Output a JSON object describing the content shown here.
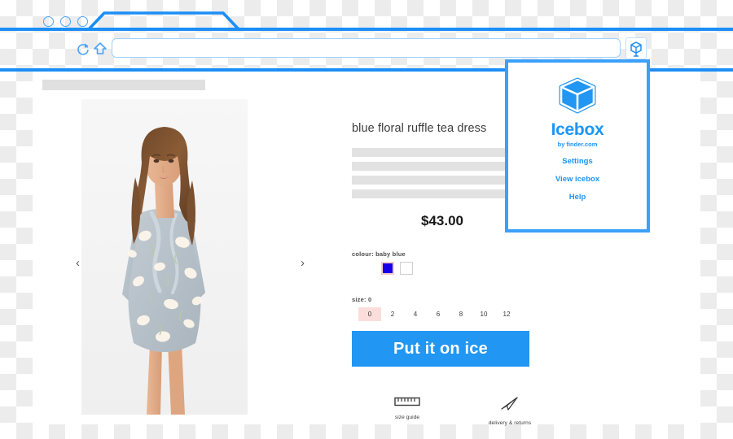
{
  "browser": {
    "traffic_lights": [
      "window-dot-1",
      "window-dot-2",
      "window-dot-3"
    ],
    "reload_icon": "reload-icon",
    "home_icon": "home-icon",
    "url_value": "",
    "url_placeholder": "",
    "extension_icon": "icebox-cube-icon",
    "accent_color": "#1b8ef7"
  },
  "page": {
    "gallery": {
      "prev_arrow": "‹",
      "next_arrow": "›",
      "image_alt": "model wearing blue floral ruffle tea dress"
    },
    "product": {
      "title": "blue floral ruffle tea dress",
      "price": "$43.00",
      "description_lines": [
        "",
        "",
        "",
        ""
      ],
      "colour_label": "colour: baby blue",
      "colours": [
        {
          "name": "baby blue",
          "hex": "#1500e8",
          "selected": true
        },
        {
          "name": "white",
          "hex": "#ffffff",
          "selected": false
        }
      ],
      "size_label": "size: 0",
      "sizes": [
        {
          "value": "0",
          "selected": true
        },
        {
          "value": "2",
          "selected": false
        },
        {
          "value": "4",
          "selected": false
        },
        {
          "value": "6",
          "selected": false
        },
        {
          "value": "8",
          "selected": false
        },
        {
          "value": "10",
          "selected": false
        },
        {
          "value": "12",
          "selected": false
        }
      ],
      "cta_label": "Put it on ice",
      "cta_color": "#2196f3",
      "selected_swatch_border": "#f9cdc9",
      "selected_size_bg": "#fbdedb",
      "footer_links": [
        {
          "label": "size guide",
          "icon": "ruler-icon"
        },
        {
          "label": "delivery & returns",
          "icon": "paper-plane-icon"
        }
      ]
    }
  },
  "popup": {
    "logo_icon": "icebox-cube-logo",
    "title": "Icebox",
    "subtitle": "by finder.com",
    "brand_color": "#1e95f7",
    "menu": [
      {
        "label": "Settings"
      },
      {
        "label": "View icebox"
      },
      {
        "label": "Help"
      }
    ]
  }
}
